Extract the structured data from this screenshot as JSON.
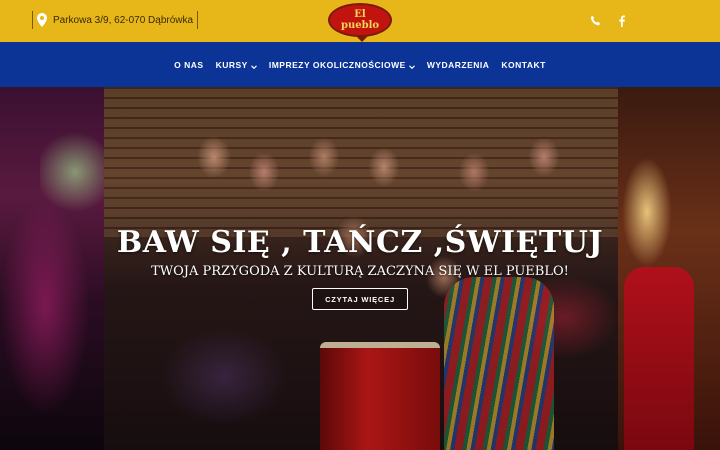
{
  "topbar": {
    "address": "Parkowa 3/9, 62-070 Dąbrówka",
    "icons": [
      "map-pin-icon",
      "phone-icon",
      "facebook-icon"
    ],
    "background_color": "#e7b71a"
  },
  "logo": {
    "line1": "El",
    "line2": "pueblo",
    "color": "#c2140e"
  },
  "nav": {
    "background_color": "#0b3496",
    "items": [
      {
        "label": "O NAS",
        "has_dropdown": false
      },
      {
        "label": "KURSY",
        "has_dropdown": true
      },
      {
        "label": "IMPREZY OKOLICZNOŚCIOWE",
        "has_dropdown": true
      },
      {
        "label": "WYDARZENIA",
        "has_dropdown": false
      },
      {
        "label": "KONTAKT",
        "has_dropdown": false
      }
    ]
  },
  "hero": {
    "title": "BAW SIĘ , TAŃCZ ,ŚWIĘTUJ",
    "subtitle": "TWOJA PRZYGODA Z KULTURĄ ZACZYNA SIĘ W EL PUEBLO!",
    "button_label": "CZYTAJ WIĘCEJ"
  }
}
